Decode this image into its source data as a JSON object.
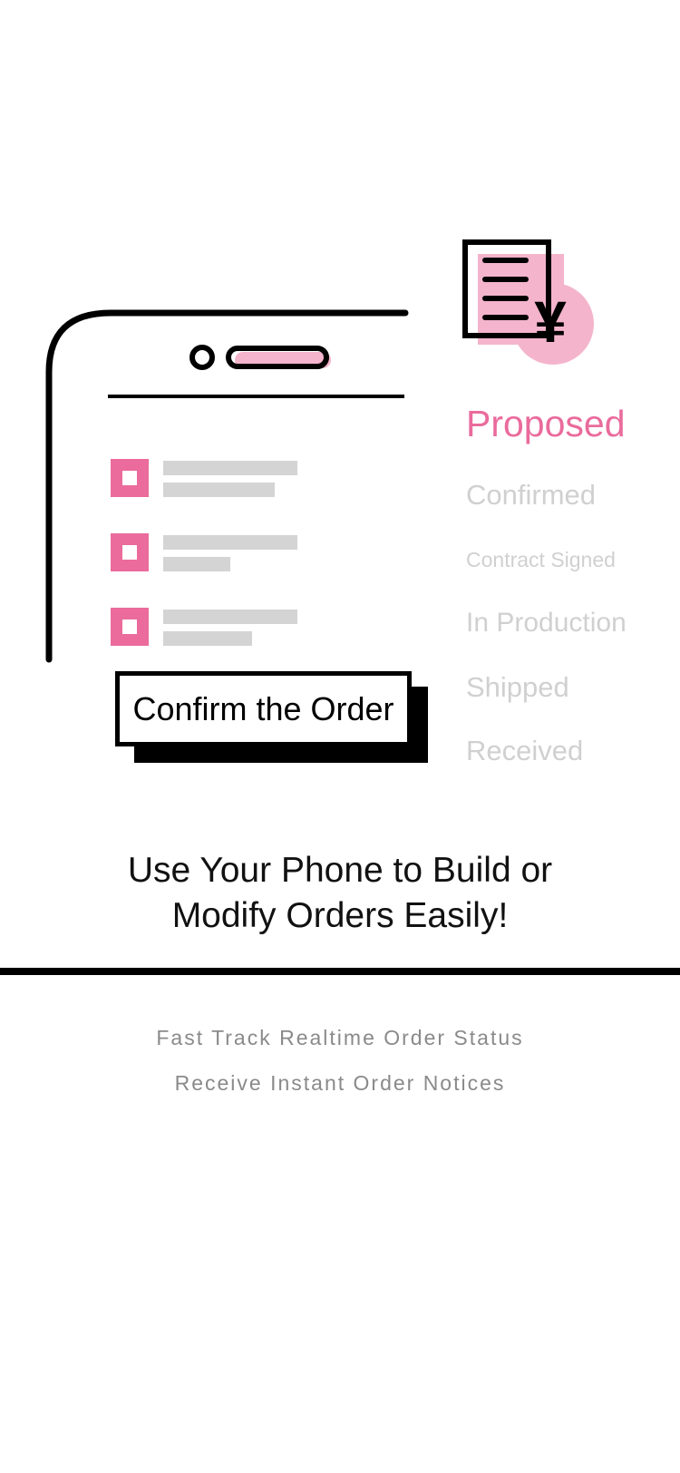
{
  "colors": {
    "accent": "#ea6b9c",
    "accent_light": "#f4b4cc",
    "muted": "#d0d0d0",
    "line": "#000000"
  },
  "illustration": {
    "icons": [
      "phone-outline",
      "invoice-yen-icon",
      "checkbox-icon"
    ],
    "statuses": [
      {
        "label": "Proposed",
        "active": true
      },
      {
        "label": "Confirmed",
        "active": false
      },
      {
        "label": "Contract Signed",
        "active": false
      },
      {
        "label": "In Production",
        "active": false
      },
      {
        "label": "Shipped",
        "active": false
      },
      {
        "label": "Received",
        "active": false
      }
    ],
    "confirm_button": "Confirm the Order",
    "invoice_symbol": "¥"
  },
  "headline": {
    "line1": "Use Your Phone to Build or",
    "line2": "Modify Orders Easily!"
  },
  "features": [
    "Fast Track Realtime Order Status",
    "Receive Instant Order Notices"
  ]
}
